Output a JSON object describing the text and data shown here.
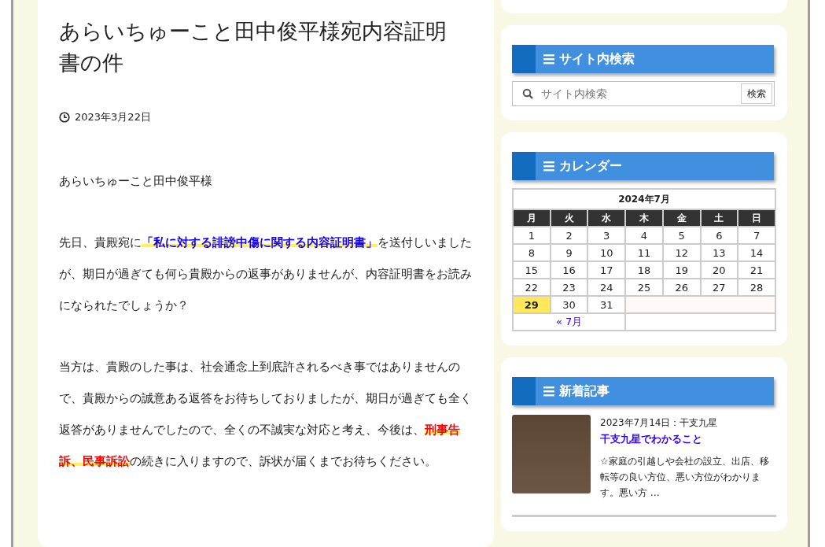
{
  "article": {
    "title": "あらいちゅーこと田中俊平様宛内容証明書の件",
    "date": "2023年3月22日",
    "paragraphs": [
      [
        {
          "kind": "plain",
          "text": "あらいちゅーこと田中俊平様"
        }
      ],
      [
        {
          "kind": "plain",
          "text": "先日、貴殿宛に"
        },
        {
          "kind": "blue-marker",
          "text": "「私に対する誹謗中傷に関する内容証明書」"
        },
        {
          "kind": "plain",
          "text": "を送付しいましたが、期日が過ぎても何ら貴殿からの返事がありませんが、内容証明書をお読みになられたでしょうか？"
        }
      ],
      [
        {
          "kind": "plain",
          "text": "当方は、貴殿のした事は、社会通念上到底許されるべき事ではありませんので、貴殿からの誠意ある返答をお待ちしておりましたが、期日が過ぎても全く返答がありませんでしたので、全くの不誠実な対応と考え、今後は、"
        },
        {
          "kind": "red-marker",
          "text": "刑事告訴、民事訴訟"
        },
        {
          "kind": "plain",
          "text": "の続きに入りますので、訴状が届くまでお待ちください。"
        }
      ]
    ]
  },
  "sidebar": {
    "search": {
      "heading": "サイト内検索",
      "placeholder": "サイト内検索",
      "button": "検索"
    },
    "calendar": {
      "heading": "カレンダー",
      "caption": "2024年7月",
      "weekdays": [
        "月",
        "火",
        "水",
        "木",
        "金",
        "土",
        "日"
      ],
      "days": [
        {
          "day": "1",
          "today": false
        },
        {
          "day": "2",
          "today": false
        },
        {
          "day": "3",
          "today": false
        },
        {
          "day": "4",
          "today": false
        },
        {
          "day": "5",
          "today": false
        },
        {
          "day": "6",
          "today": false
        },
        {
          "day": "7",
          "today": false
        },
        {
          "day": "8",
          "today": false
        },
        {
          "day": "9",
          "today": false
        },
        {
          "day": "10",
          "today": false
        },
        {
          "day": "11",
          "today": false
        },
        {
          "day": "12",
          "today": false
        },
        {
          "day": "13",
          "today": false
        },
        {
          "day": "14",
          "today": false
        },
        {
          "day": "15",
          "today": false
        },
        {
          "day": "16",
          "today": false
        },
        {
          "day": "17",
          "today": false
        },
        {
          "day": "18",
          "today": false
        },
        {
          "day": "19",
          "today": false
        },
        {
          "day": "20",
          "today": false
        },
        {
          "day": "21",
          "today": false
        },
        {
          "day": "22",
          "today": false
        },
        {
          "day": "23",
          "today": false
        },
        {
          "day": "24",
          "today": false
        },
        {
          "day": "25",
          "today": false
        },
        {
          "day": "26",
          "today": false
        },
        {
          "day": "27",
          "today": false
        },
        {
          "day": "28",
          "today": false
        },
        {
          "day": "29",
          "today": true
        },
        {
          "day": "30",
          "today": false
        },
        {
          "day": "31",
          "today": false
        }
      ],
      "prev": "« 7月"
    },
    "recent": {
      "heading": "新着記事",
      "posts": [
        {
          "meta": "2023年7月14日：干支九星",
          "title": "干支九星でわかること",
          "excerpt": "☆家庭の引越しや会社の設立、出店、移転等の良い方位、悪い方位がわかります。悪い方 …"
        }
      ]
    }
  }
}
